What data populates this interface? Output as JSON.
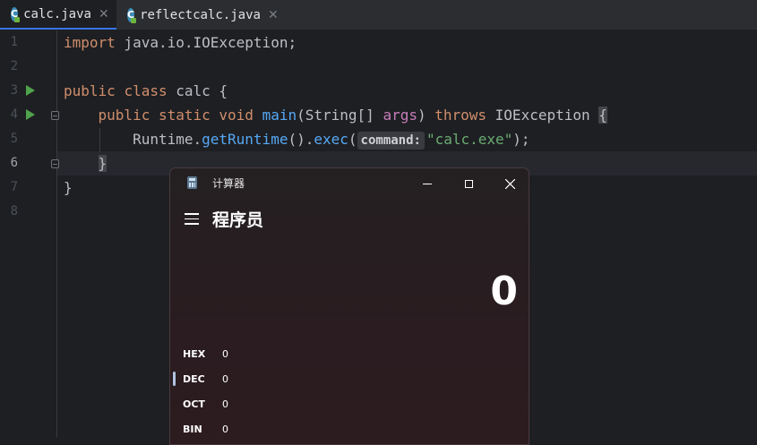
{
  "tabs": [
    {
      "label": "calc.java",
      "active": true
    },
    {
      "label": "reflectcalc.java",
      "active": false
    }
  ],
  "editor": {
    "line_numbers": [
      "1",
      "2",
      "3",
      "4",
      "5",
      "6",
      "7",
      "8"
    ],
    "current_line": "6",
    "lines": {
      "l1_kw": "import",
      "l1_rest": " java.io.IOException;",
      "l3_kw1": "public",
      "l3_kw2": "class",
      "l3_name": "calc",
      "l3_brace": "{",
      "l4_kw1": "public",
      "l4_kw2": "static",
      "l4_kw3": "void",
      "l4_fn": "main",
      "l4_sig_open": "(String[] ",
      "l4_param": "args",
      "l4_sig_close": ") ",
      "l4_throws": "throws",
      "l4_ex": " IOException ",
      "l4_brace": "{",
      "l5_cls": "Runtime.",
      "l5_fn1": "getRuntime",
      "l5_mid": "().",
      "l5_fn2": "exec",
      "l5_paren": "(",
      "l5_hint": "command:",
      "l5_str": "\"calc.exe\"",
      "l5_end": ");",
      "l6": "}",
      "l7": "}"
    }
  },
  "calculator": {
    "window_title": "计算器",
    "mode": "程序员",
    "display_value": "0",
    "radix": [
      {
        "label": "HEX",
        "value": "0"
      },
      {
        "label": "DEC",
        "value": "0"
      },
      {
        "label": "OCT",
        "value": "0"
      },
      {
        "label": "BIN",
        "value": "0"
      }
    ],
    "selected_radix": "DEC"
  },
  "colors": {
    "editor_bg": "#1e1f22",
    "keyword": "#cf8e6d",
    "function": "#56a8f5",
    "string": "#6aab73",
    "run_icon": "#4fa34c"
  }
}
